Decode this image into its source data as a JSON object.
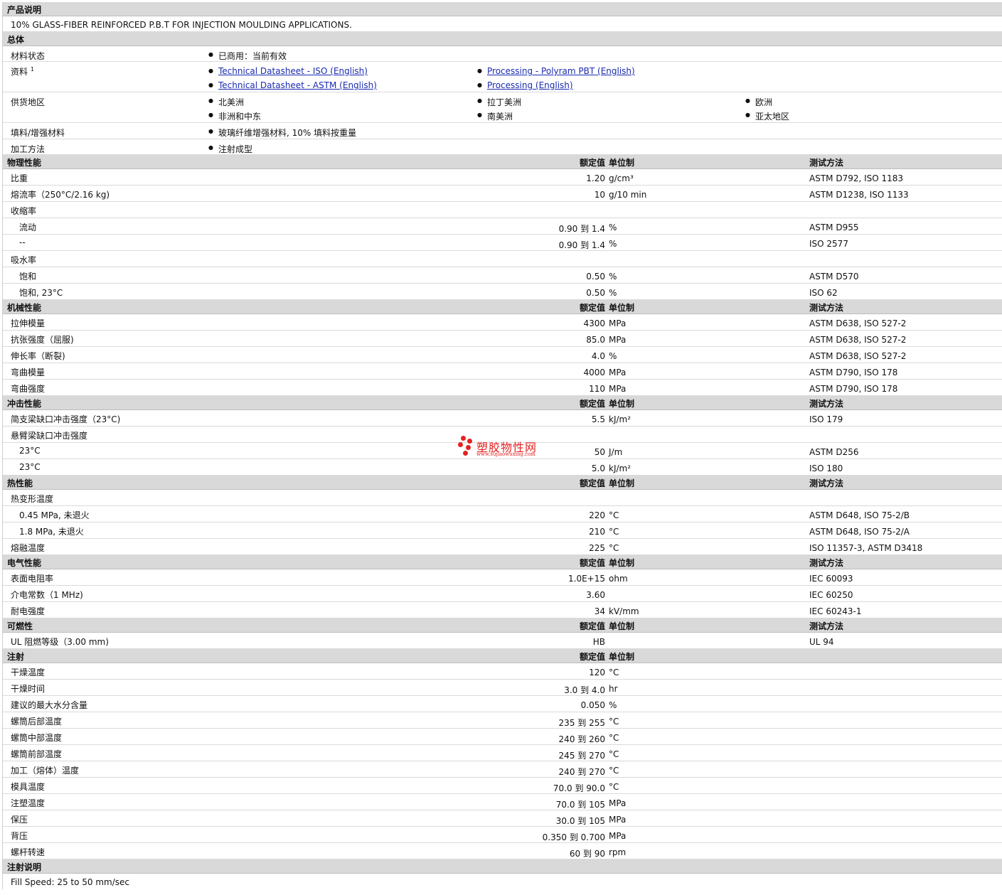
{
  "sections": {
    "description": {
      "title": "产品说明",
      "text": "10% GLASS-FIBER REINFORCED P.B.T FOR INJECTION MOULDING APPLICATIONS."
    },
    "general": {
      "title": "总体",
      "material_status": {
        "label": "材料状态",
        "value": "已商用：当前有效"
      },
      "literature": {
        "label": "资料",
        "sup": "1",
        "links": [
          "Technical Datasheet - ISO (English)",
          "Technical Datasheet - ASTM (English)",
          "Processing - Polyram PBT (English)",
          "Processing (English)"
        ]
      },
      "availability": {
        "label": "供货地区",
        "regions": [
          "北美洲",
          "非洲和中东",
          "拉丁美洲",
          "南美洲",
          "欧洲",
          "亚太地区"
        ]
      },
      "filler": {
        "label": "填料/增强材料",
        "value": "玻璃纤维增强材料, 10% 填料按重量"
      },
      "processing_method": {
        "label": "加工方法",
        "value": "注射成型"
      }
    },
    "header_cols": {
      "nominal": "额定值",
      "unit": "单位制",
      "test": "测试方法"
    },
    "physical": {
      "title": "物理性能",
      "rows": [
        {
          "label": "比重",
          "value": "1.20",
          "unit": "g/cm³",
          "test": "ASTM D792, ISO 1183"
        },
        {
          "label": "熔流率（250°C/2.16 kg)",
          "value": "10",
          "unit": "g/10 min",
          "test": "ASTM D1238, ISO 1133"
        },
        {
          "label": "收缩率",
          "value": "",
          "unit": "",
          "test": ""
        },
        {
          "label": "流动",
          "value": "0.90 到  1.4",
          "unit": "%",
          "test": "ASTM D955"
        },
        {
          "label": "--",
          "value": "0.90 到  1.4",
          "unit": "%",
          "test": "ISO 2577"
        },
        {
          "label": "吸水率",
          "value": "",
          "unit": "",
          "test": ""
        },
        {
          "label": "饱和",
          "value": "0.50",
          "unit": "%",
          "test": "ASTM D570"
        },
        {
          "label": "饱和, 23°C",
          "value": "0.50",
          "unit": "%",
          "test": "ISO 62"
        }
      ]
    },
    "mechanical": {
      "title": "机械性能",
      "rows": [
        {
          "label": "拉伸模量",
          "value": "4300",
          "unit": "MPa",
          "test": "ASTM D638, ISO 527-2"
        },
        {
          "label": "抗张强度（屈服)",
          "value": "85.0",
          "unit": "MPa",
          "test": "ASTM D638, ISO 527-2"
        },
        {
          "label": "伸长率（断裂)",
          "value": "4.0",
          "unit": "%",
          "test": "ASTM D638, ISO 527-2"
        },
        {
          "label": "弯曲模量",
          "value": "4000",
          "unit": "MPa",
          "test": "ASTM D790, ISO 178"
        },
        {
          "label": "弯曲强度",
          "value": "110",
          "unit": "MPa",
          "test": "ASTM D790, ISO 178"
        }
      ]
    },
    "impact": {
      "title": "冲击性能",
      "rows": [
        {
          "label": "简支梁缺口冲击强度（23°C)",
          "value": "5.5",
          "unit": "kJ/m²",
          "test": "ISO 179"
        },
        {
          "label": "悬臂梁缺口冲击强度",
          "value": "",
          "unit": "",
          "test": ""
        },
        {
          "label": "23°C",
          "value": "50",
          "unit": "J/m",
          "test": "ASTM D256"
        },
        {
          "label": "23°C",
          "value": "5.0",
          "unit": "kJ/m²",
          "test": "ISO 180"
        }
      ]
    },
    "thermal": {
      "title": "热性能",
      "rows": [
        {
          "label": "热变形温度",
          "value": "",
          "unit": "",
          "test": ""
        },
        {
          "label": "0.45 MPa, 未退火",
          "value": "220",
          "unit": "°C",
          "test": "ASTM D648, ISO 75-2/B"
        },
        {
          "label": "1.8 MPa, 未退火",
          "value": "210",
          "unit": "°C",
          "test": "ASTM D648, ISO 75-2/A"
        },
        {
          "label": "熔融温度",
          "value": "225",
          "unit": "°C",
          "test": "ISO 11357-3, ASTM D3418"
        }
      ]
    },
    "electrical": {
      "title": "电气性能",
      "rows": [
        {
          "label": "表面电阻率",
          "value": "1.0E+15",
          "unit": "ohm",
          "test": "IEC 60093"
        },
        {
          "label": "介电常数（1 MHz)",
          "value": "3.60",
          "unit": "",
          "test": "IEC 60250"
        },
        {
          "label": "耐电强度",
          "value": "34",
          "unit": "kV/mm",
          "test": "IEC 60243-1"
        }
      ]
    },
    "flammability": {
      "title": "可燃性",
      "rows": [
        {
          "label": "UL 阻燃等级（3.00 mm)",
          "value": "HB",
          "unit": "",
          "test": "UL 94"
        }
      ]
    },
    "injection": {
      "title": "注射",
      "rows": [
        {
          "label": "干燥温度",
          "value": "120",
          "unit": "°C"
        },
        {
          "label": "干燥时间",
          "value": "3.0 到  4.0",
          "unit": "hr"
        },
        {
          "label": "建议的最大水分含量",
          "value": "0.050",
          "unit": "%"
        },
        {
          "label": "螺筒后部温度",
          "value": "235 到  255",
          "unit": "°C"
        },
        {
          "label": "螺筒中部温度",
          "value": "240 到  260",
          "unit": "°C"
        },
        {
          "label": "螺筒前部温度",
          "value": "245 到  270",
          "unit": "°C"
        },
        {
          "label": "加工（熔体）温度",
          "value": "240 到  270",
          "unit": "°C"
        },
        {
          "label": "模具温度",
          "value": "70.0 到  90.0",
          "unit": "°C"
        },
        {
          "label": "注塑温度",
          "value": "70.0 到  105",
          "unit": "MPa"
        },
        {
          "label": "保压",
          "value": "30.0 到  105",
          "unit": "MPa"
        },
        {
          "label": "背压",
          "value": "0.350 到  0.700",
          "unit": "MPa"
        },
        {
          "label": "螺杆转速",
          "value": "60 到  90",
          "unit": "rpm"
        }
      ]
    },
    "injection_notes": {
      "title": "注射说明",
      "text": "Fill Speed: 25 to 50 mm/sec"
    }
  },
  "watermark": {
    "name": "塑胶物性网",
    "url": "www.sujiaowuxing.com",
    "color": "#e42121"
  }
}
